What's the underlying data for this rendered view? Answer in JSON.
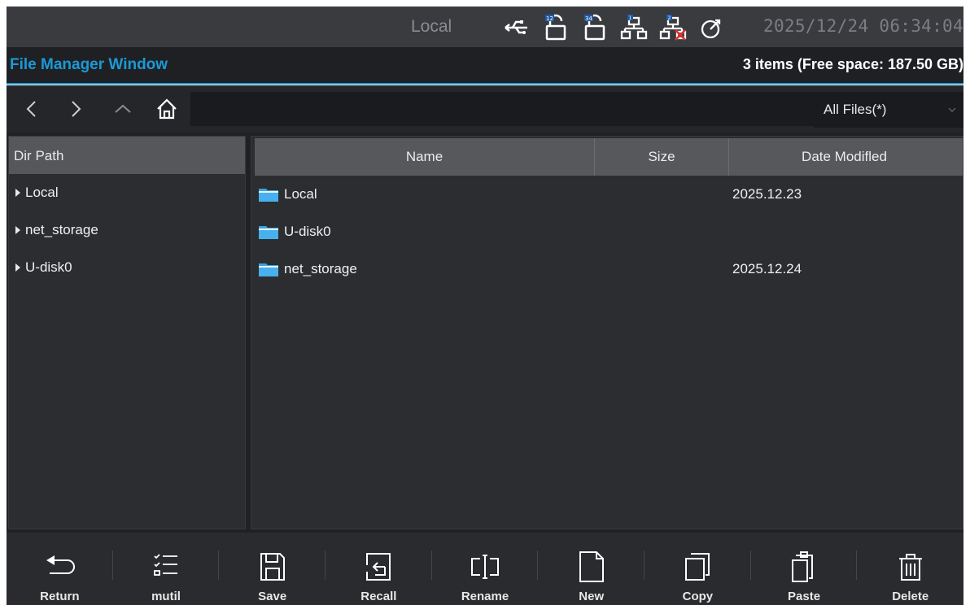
{
  "status": {
    "location": "Local",
    "datetime": "2025/12/24 06:34:04",
    "icons": [
      "usb-icon",
      "lock-12-icon",
      "lock-34-icon",
      "network-1-icon",
      "network-2-disconnected-icon",
      "timer-icon"
    ]
  },
  "header": {
    "title": "File Manager Window",
    "info": "3 items (Free space: 187.50 GB)"
  },
  "nav": {
    "filter": "All Files(*)"
  },
  "tree": {
    "header": "Dir Path",
    "items": [
      {
        "label": "Local"
      },
      {
        "label": "net_storage"
      },
      {
        "label": "U-disk0"
      }
    ]
  },
  "table": {
    "columns": [
      "Name",
      "Size",
      "Date Modifled"
    ],
    "rows": [
      {
        "name": "Local",
        "size": "",
        "date": "2025.12.23"
      },
      {
        "name": "U-disk0",
        "size": "",
        "date": ""
      },
      {
        "name": "net_storage",
        "size": "",
        "date": "2025.12.24"
      }
    ]
  },
  "toolbar": {
    "items": [
      "Return",
      "mutil",
      "Save",
      "Recall",
      "Rename",
      "New",
      "Copy",
      "Paste",
      "Delete"
    ]
  },
  "colors": {
    "accent": "#1b9ad6",
    "folder": "#3aa3e0"
  }
}
